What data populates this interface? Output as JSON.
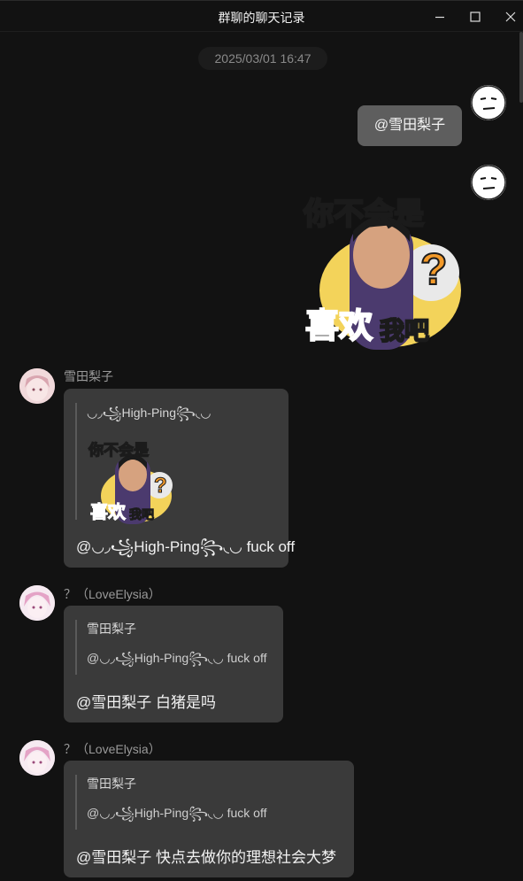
{
  "window": {
    "title": "群聊的聊天记录",
    "buttons": {
      "minimize": "minimize-icon",
      "maximize": "maximize-icon",
      "close": "close-icon"
    }
  },
  "timestamp": "2025/03/01 16:47",
  "self_messages": [
    {
      "text": "@雪田梨子",
      "avatar_icon": "neutral-face-icon"
    },
    {
      "avatar_icon": "neutral-face-icon",
      "sticker": {
        "line1": "你不会是",
        "line2_a": "喜欢",
        "line2_b": "我吧",
        "mark": "?"
      }
    }
  ],
  "threads": [
    {
      "sender": "雪田梨子",
      "quote": {
        "name": "◡◞꧁High-Ping꧂◟◡",
        "sticker": {
          "line1": "你不会是",
          "line2_a": "喜欢",
          "line2_b": "我吧",
          "mark": "?"
        }
      },
      "text": "@◡◞꧁High-Ping꧂◟◡ fuck off"
    },
    {
      "sender": "？（LoveElysia）",
      "quote": {
        "name": "雪田梨子",
        "text": "@◡◞꧁High-Ping꧂◟◡ fuck off"
      },
      "text": "@雪田梨子 白猪是吗"
    },
    {
      "sender": "？（LoveElysia）",
      "quote": {
        "name": "雪田梨子",
        "text": "@◡◞꧁High-Ping꧂◟◡ fuck off"
      },
      "text": "@雪田梨子 快点去做你的理想社会大梦"
    }
  ],
  "colors": {
    "background": "#121212",
    "bubble_self": "#5e5e5e",
    "card": "#3a3a3a",
    "sticker_yellow": "#f3d35a",
    "sticker_red": "#e2425c"
  }
}
